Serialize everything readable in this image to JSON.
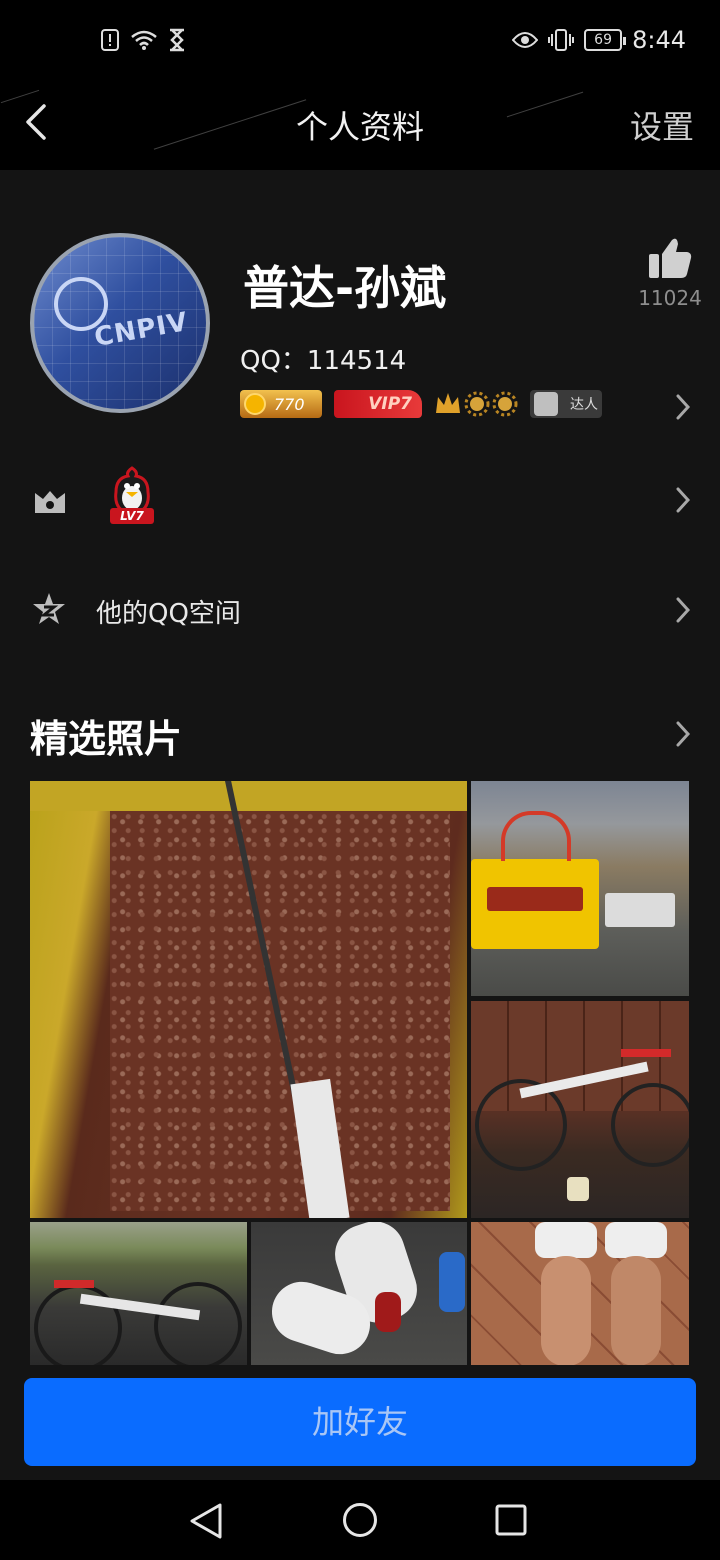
{
  "status_bar": {
    "time": "8:44",
    "battery": "69",
    "icons": [
      "sim-alert-icon",
      "wifi-icon",
      "hourglass-icon",
      "eye-icon",
      "vibrate-icon"
    ]
  },
  "header": {
    "title": "个人资料",
    "settings_label": "设置"
  },
  "profile": {
    "nickname": "普达-孙斌",
    "qq_line": "QQ：114514",
    "like_count": "11024",
    "avatar_text": "CNPIV",
    "badges": {
      "level_value": "770",
      "vip_label": "VIP7",
      "expert_label": "达人"
    }
  },
  "rows": {
    "penguin_level": "LV7",
    "qzone_label": "他的QQ空间"
  },
  "photos_section": {
    "title": "精选照片",
    "photos": [
      {
        "subject": "bait-mix-bucket"
      },
      {
        "subject": "fishing-bag-rocks"
      },
      {
        "subject": "road-bike-indoor"
      },
      {
        "subject": "road-bike-outdoor"
      },
      {
        "subject": "cycling-shoes"
      },
      {
        "subject": "legs-cycling-shoes"
      }
    ]
  },
  "actions": {
    "add_friend_label": "加好友"
  },
  "colors": {
    "accent": "#0a6cff",
    "background": "#141414",
    "bar": "#000000"
  }
}
